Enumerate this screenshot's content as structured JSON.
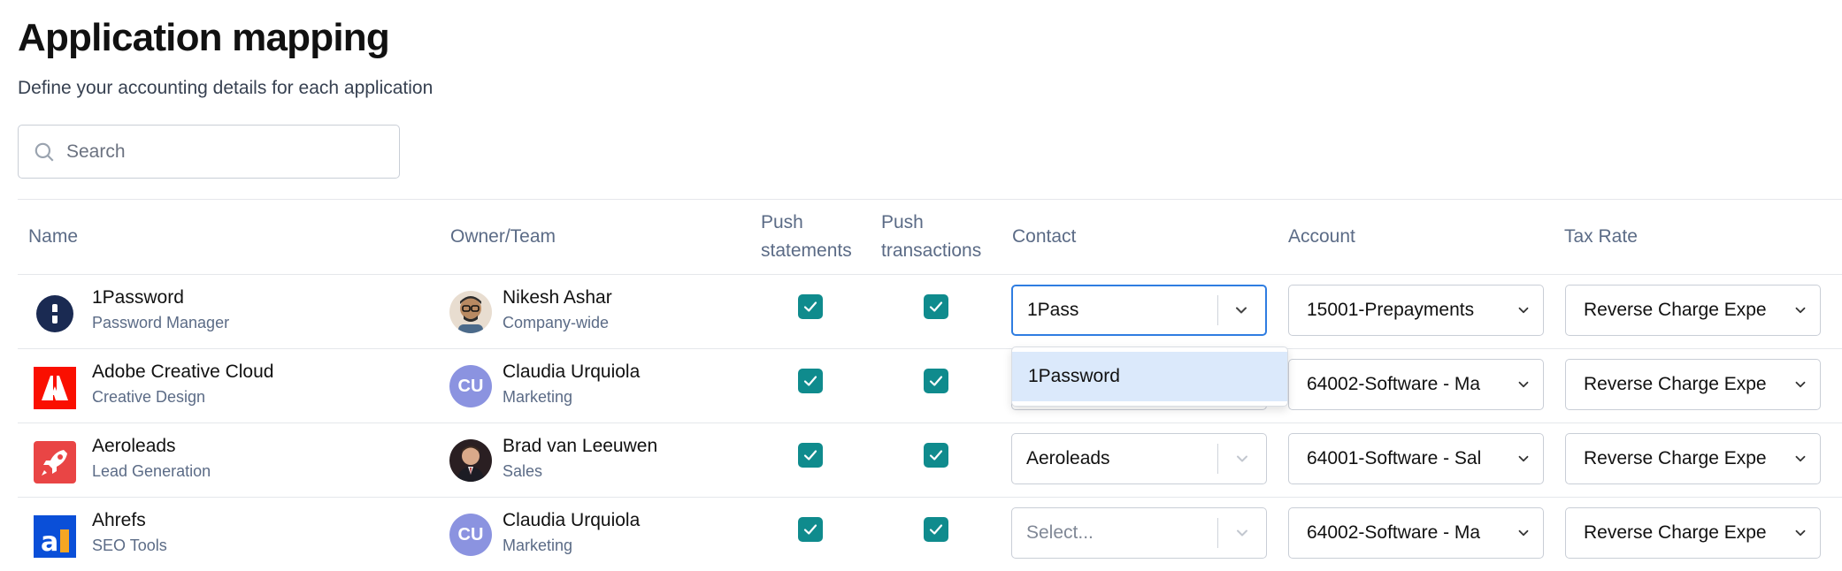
{
  "page": {
    "title": "Application mapping",
    "subtitle": "Define your accounting details for each application"
  },
  "search": {
    "placeholder": "Search",
    "value": ""
  },
  "columns": {
    "name": "Name",
    "owner": "Owner/Team",
    "push_statements_1": "Push",
    "push_statements_2": "statements",
    "push_transactions_1": "Push",
    "push_transactions_2": "transactions",
    "contact": "Contact",
    "account": "Account",
    "tax_rate": "Tax Rate"
  },
  "rows": [
    {
      "name": "1Password",
      "category": "Password Manager",
      "logo": "1password-logo",
      "owner": "Nikesh Ashar",
      "team": "Company-wide",
      "avatar": "photo",
      "push_statements": true,
      "push_transactions": true,
      "contact": "1Pass",
      "account": "15001-Prepayments",
      "tax_rate": "Reverse Charge Expe"
    },
    {
      "name": "Adobe Creative Cloud",
      "category": "Creative Design",
      "logo": "adobe-logo",
      "owner": "Claudia Urquiola",
      "team": "Marketing",
      "avatar_initials": "CU",
      "push_statements": true,
      "push_transactions": true,
      "contact": "",
      "account": "64002-Software - Ma",
      "tax_rate": "Reverse Charge Expe"
    },
    {
      "name": "Aeroleads",
      "category": "Lead Generation",
      "logo": "aeroleads-logo",
      "owner": "Brad van Leeuwen",
      "team": "Sales",
      "avatar": "photo",
      "push_statements": true,
      "push_transactions": true,
      "contact": "Aeroleads",
      "account": "64001-Software - Sal",
      "tax_rate": "Reverse Charge Expe"
    },
    {
      "name": "Ahrefs",
      "category": "SEO Tools",
      "logo": "ahrefs-logo",
      "owner": "Claudia Urquiola",
      "team": "Marketing",
      "avatar_initials": "CU",
      "push_statements": true,
      "push_transactions": true,
      "contact_placeholder": "Select...",
      "account": "64002-Software - Ma",
      "tax_rate": "Reverse Charge Expe"
    }
  ],
  "contact_dropdown": {
    "options": [
      "1Password"
    ]
  },
  "colors": {
    "checkbox": "#0f8b8d",
    "focus": "#2f7de1",
    "option_highlight": "#dbe9fb",
    "avatar_initials_bg": "#8b93e0"
  }
}
